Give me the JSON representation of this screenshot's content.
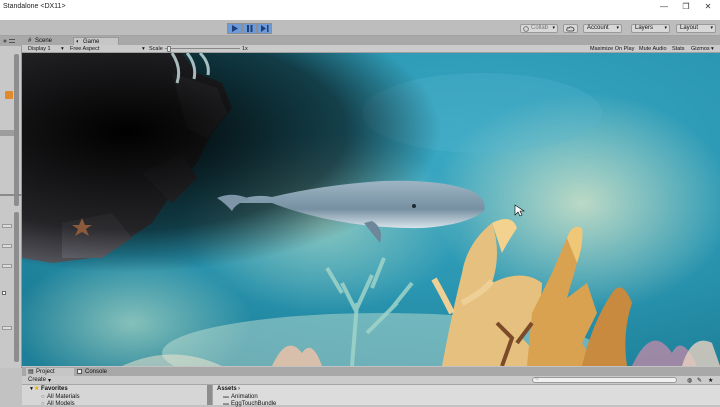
{
  "window": {
    "title": "Standalone <DX11>",
    "minimize": "—",
    "restore": "❐",
    "close": "✕"
  },
  "toolbar": {
    "collab_label": "Collab",
    "account_label": "Account",
    "layers_label": "Layers",
    "layout_label": "Layout"
  },
  "tabs": {
    "scene": "Scene",
    "game": "Game"
  },
  "gamebar": {
    "display": "Display 1",
    "aspect": "Free Aspect",
    "scale_label": "Scale",
    "scale_value": "1x",
    "maximize": "Maximize On Play",
    "mute": "Mute Audio",
    "stats": "Stats",
    "gizmos": "Gizmos"
  },
  "bottom": {
    "project_tab": "Project",
    "console_tab": "Console",
    "create_label": "Create",
    "favorites_label": "Favorites",
    "favorites_items": [
      "All Materials",
      "All Models"
    ],
    "assets_label": "Assets",
    "asset_items": [
      "Animation",
      "EggTouchBundle"
    ]
  },
  "colors": {
    "play_active": "#6f9ad8",
    "water": "#2b97b2",
    "whale": "#8aa3b4"
  }
}
